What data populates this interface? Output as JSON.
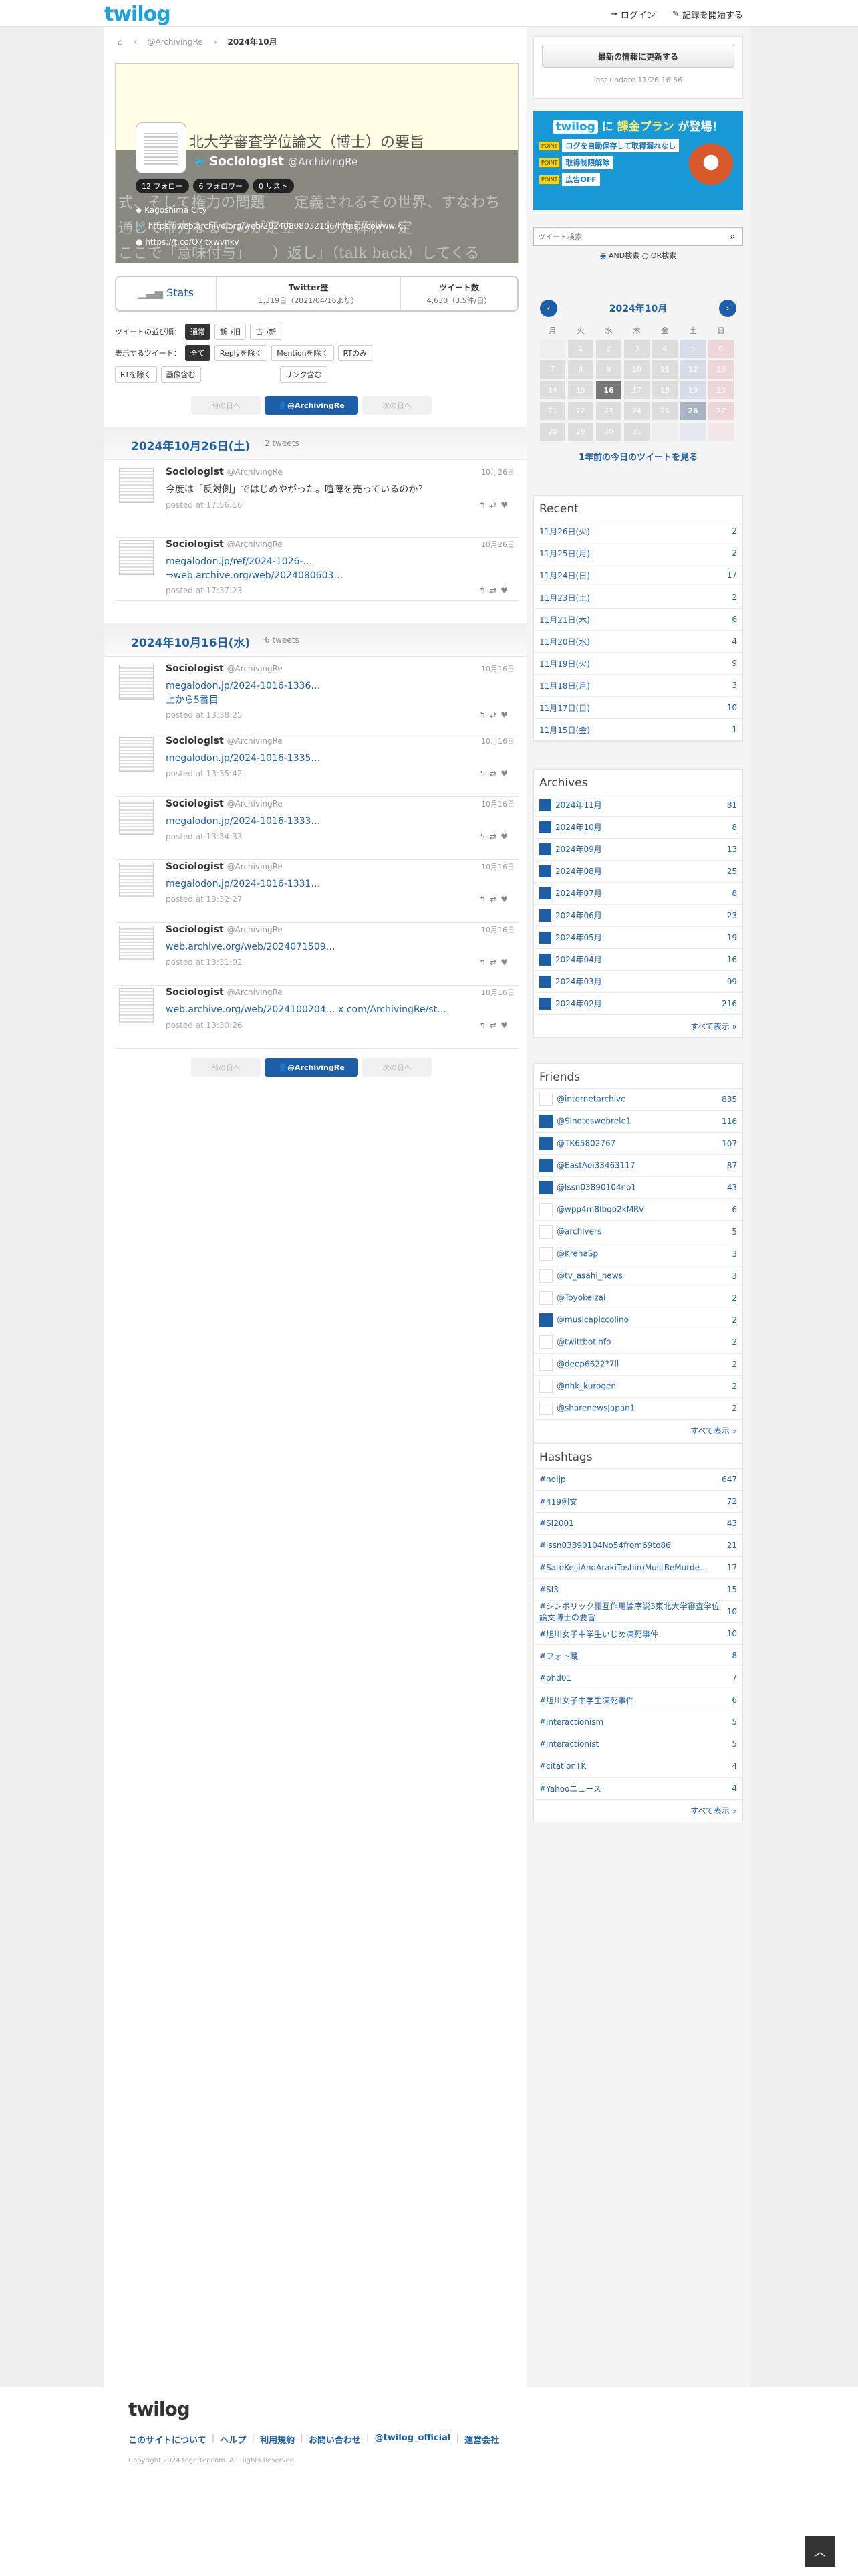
{
  "header": {
    "logo": "twilog",
    "login": "ログイン",
    "start": "記録を開始する"
  },
  "breadcrumb": {
    "user": "@ArchivingRe",
    "month": "2024年10月"
  },
  "profile": {
    "bg_line1": "北大学審査学位論文（博士）の要旨",
    "bg_line2": "式、そして権力の問題　　定義されるその世界、すなわち",
    "bg_line3": "通じて権力なるものが定立　　した解釈・定",
    "bg_line4": "ここで「意味付与」　　）返し」（talk back）してくる",
    "name": "Sociologist",
    "handle": "@ArchivingRe",
    "following": "12 フォロー",
    "followers": "6 フォロワー",
    "lists": "0 リスト",
    "location": "Kagoshima City",
    "url": "https://web.archive.org/web/20240808032156/https://cowww.k...",
    "link2": "https://t.co/Q7itxwvnkv"
  },
  "stats": {
    "label": "Stats",
    "twitter_history_title": "Twitter歴",
    "twitter_history_value": "1,319日（2021/04/16より）",
    "tweet_count_title": "ツイート数",
    "tweet_count_value": "4,630（3.5件/日）"
  },
  "order": {
    "label": "ツイートの並び順：",
    "opts": [
      "通常",
      "新→旧",
      "古→新"
    ]
  },
  "filter": {
    "label": "表示するツイート：",
    "opts": [
      "全て",
      "Replyを除く",
      "Mentionを除く",
      "RTのみ",
      "RTを除く",
      "画像含む",
      "リンク含む"
    ]
  },
  "pager": {
    "prev": "前の日へ",
    "user": "@ArchivingRe",
    "next": "次の日へ"
  },
  "days": [
    {
      "date": "2024年10月26日(土)",
      "count": "2 tweets",
      "tweets": [
        {
          "name": "Sociologist",
          "handle": "@ArchivingRe",
          "date": "10月26日",
          "body": "今度は「反対側」ではじめやがった。喧嘩を売っているのか？",
          "time": "posted at 17:56:16"
        },
        {
          "name": "Sociologist",
          "handle": "@ArchivingRe",
          "date": "10月26日",
          "body": "megalodon.jp/ref/2024-1026-…\n⇒web.archive.org/web/2024080603…",
          "time": "posted at 17:37:23"
        }
      ]
    },
    {
      "date": "2024年10月16日(水)",
      "count": "6 tweets",
      "tweets": [
        {
          "name": "Sociologist",
          "handle": "@ArchivingRe",
          "date": "10月16日",
          "body": "megalodon.jp/2024-1016-1336…\n上から5番目",
          "time": "posted at 13:38:25"
        },
        {
          "name": "Sociologist",
          "handle": "@ArchivingRe",
          "date": "10月16日",
          "body": "megalodon.jp/2024-1016-1335…",
          "time": "posted at 13:35:42"
        },
        {
          "name": "Sociologist",
          "handle": "@ArchivingRe",
          "date": "10月16日",
          "body": "megalodon.jp/2024-1016-1333…",
          "time": "posted at 13:34:33"
        },
        {
          "name": "Sociologist",
          "handle": "@ArchivingRe",
          "date": "10月16日",
          "body": "megalodon.jp/2024-1016-1331…",
          "time": "posted at 13:32:27"
        },
        {
          "name": "Sociologist",
          "handle": "@ArchivingRe",
          "date": "10月16日",
          "body": "web.archive.org/web/2024071509…",
          "time": "posted at 13:31:02"
        },
        {
          "name": "Sociologist",
          "handle": "@ArchivingRe",
          "date": "10月16日",
          "body": "web.archive.org/web/2024100204… x.com/ArchivingRe/st…",
          "time": "posted at 13:30:26"
        }
      ]
    }
  ],
  "side": {
    "update_btn": "最新の情報に更新する",
    "last_update": "last update 11/26 16:56",
    "banner_title_pre": "twilog",
    "banner_title_mid": "に",
    "banner_title_hl": "課金プラン",
    "banner_title_post": "が登場！",
    "banner_points": [
      "ログを自動保存して取得漏れなし",
      "取得制限解除",
      "広告OFF"
    ],
    "point_label": "POINT",
    "search_placeholder": "ツイート検索",
    "and_label": "AND検索",
    "or_label": "OR検索",
    "calendar_title": "2024年10月",
    "weekdays": [
      "月",
      "火",
      "水",
      "木",
      "金",
      "土",
      "日"
    ],
    "calendar_days": [
      "",
      "1",
      "2",
      "3",
      "4",
      "5",
      "6",
      "7",
      "8",
      "9",
      "10",
      "11",
      "12",
      "13",
      "14",
      "15",
      "16",
      "17",
      "18",
      "19",
      "20",
      "21",
      "22",
      "23",
      "24",
      "25",
      "26",
      "27",
      "28",
      "29",
      "30",
      "31",
      "",
      "",
      ""
    ],
    "year_ago_link": "1年前の今日のツイートを見る",
    "recent_title": "Recent",
    "recent": [
      {
        "label": "11月26日(火)",
        "n": "2"
      },
      {
        "label": "11月25日(月)",
        "n": "2"
      },
      {
        "label": "11月24日(日)",
        "n": "17"
      },
      {
        "label": "11月23日(土)",
        "n": "2"
      },
      {
        "label": "11月21日(木)",
        "n": "6"
      },
      {
        "label": "11月20日(水)",
        "n": "4"
      },
      {
        "label": "11月19日(火)",
        "n": "9"
      },
      {
        "label": "11月18日(月)",
        "n": "3"
      },
      {
        "label": "11月17日(日)",
        "n": "10"
      },
      {
        "label": "11月15日(金)",
        "n": "1"
      }
    ],
    "archives_title": "Archives",
    "archives": [
      {
        "label": "2024年11月",
        "n": "81"
      },
      {
        "label": "2024年10月",
        "n": "8"
      },
      {
        "label": "2024年09月",
        "n": "13"
      },
      {
        "label": "2024年08月",
        "n": "25"
      },
      {
        "label": "2024年07月",
        "n": "8"
      },
      {
        "label": "2024年06月",
        "n": "23"
      },
      {
        "label": "2024年05月",
        "n": "19"
      },
      {
        "label": "2024年04月",
        "n": "16"
      },
      {
        "label": "2024年03月",
        "n": "99"
      },
      {
        "label": "2024年02月",
        "n": "216"
      }
    ],
    "friends_title": "Friends",
    "friends": [
      {
        "label": "@internetarchive",
        "n": "835",
        "blue": false
      },
      {
        "label": "@Slnoteswebrele1",
        "n": "116",
        "blue": true
      },
      {
        "label": "@TK65802767",
        "n": "107",
        "blue": true
      },
      {
        "label": "@EastAoi33463117",
        "n": "87",
        "blue": true
      },
      {
        "label": "@lssn03890104no1",
        "n": "43",
        "blue": true
      },
      {
        "label": "@wpp4m8Ibqo2kMRV",
        "n": "6",
        "blue": false
      },
      {
        "label": "@archivers",
        "n": "5",
        "blue": false
      },
      {
        "label": "@KrehaSp",
        "n": "3",
        "blue": false
      },
      {
        "label": "@tv_asahi_news",
        "n": "3",
        "blue": false
      },
      {
        "label": "@Toyokeizai",
        "n": "2",
        "blue": false
      },
      {
        "label": "@musicapiccolino",
        "n": "2",
        "blue": true
      },
      {
        "label": "@twittbotinfo",
        "n": "2",
        "blue": false
      },
      {
        "label": "@deep6622?7ll",
        "n": "2",
        "blue": false
      },
      {
        "label": "@nhk_kurogen",
        "n": "2",
        "blue": false
      },
      {
        "label": "@sharenewsJapan1",
        "n": "2",
        "blue": false
      }
    ],
    "hashtags_title": "Hashtags",
    "hashtags": [
      {
        "label": "#ndljp",
        "n": "647"
      },
      {
        "label": "#419例文",
        "n": "72"
      },
      {
        "label": "#SI2001",
        "n": "43"
      },
      {
        "label": "#lssn03890104No54from69to86",
        "n": "21"
      },
      {
        "label": "#SatoKeijiAndArakiToshiroMustBeMurde…",
        "n": "17"
      },
      {
        "label": "#SI3",
        "n": "15"
      },
      {
        "label": "#シンボリック相互作用論序説3東北大学審査学位論文博士の要旨",
        "n": "10"
      },
      {
        "label": "#旭川女子中学生いじめ凍死事件",
        "n": "10"
      },
      {
        "label": "#フォト蔵",
        "n": "8"
      },
      {
        "label": "#phd01",
        "n": "7"
      },
      {
        "label": "#旭川女子中学生凍死事件",
        "n": "6"
      },
      {
        "label": "#interactionism",
        "n": "5"
      },
      {
        "label": "#interactionist",
        "n": "5"
      },
      {
        "label": "#citationTK",
        "n": "4"
      },
      {
        "label": "#Yahooニュース",
        "n": "4"
      }
    ],
    "see_all": "すべて表示 »"
  },
  "footer": {
    "logo": "twilog",
    "links": [
      "このサイトについて",
      "ヘルプ",
      "利用規約",
      "お問い合わせ",
      "@twilog_official",
      "運営会社"
    ],
    "copyright": "Copyright 2024 togetter.com. All Rights Reserved."
  },
  "colors": {
    "accent": "#1d5fa6",
    "brand": "#1aa1e0",
    "banner": "#1898d5"
  }
}
